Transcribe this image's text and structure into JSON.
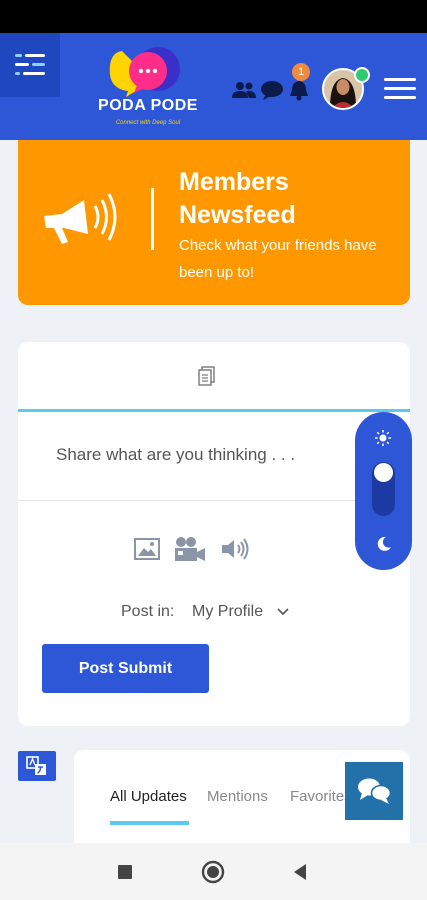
{
  "app": {
    "name": "PODA PODE",
    "tagline": "Connect with Deep Soul",
    "notification_count": "1"
  },
  "banner": {
    "title": "Members Newsfeed",
    "subtitle": "Check what your friends have been up to!"
  },
  "composer": {
    "placeholder": "Share what are you thinking . . .",
    "post_in_label": "Post in:",
    "post_in_value": "My Profile",
    "submit_label": "Post Submit"
  },
  "feed_tabs": [
    "All Updates",
    "Mentions",
    "Favorites"
  ],
  "theme": {
    "mode": "light"
  },
  "colors": {
    "header": "#2d57d6",
    "banner": "#ff9800",
    "accent": "#5ccaf0",
    "badge": "#f08a3c",
    "online": "#2ecc71"
  }
}
